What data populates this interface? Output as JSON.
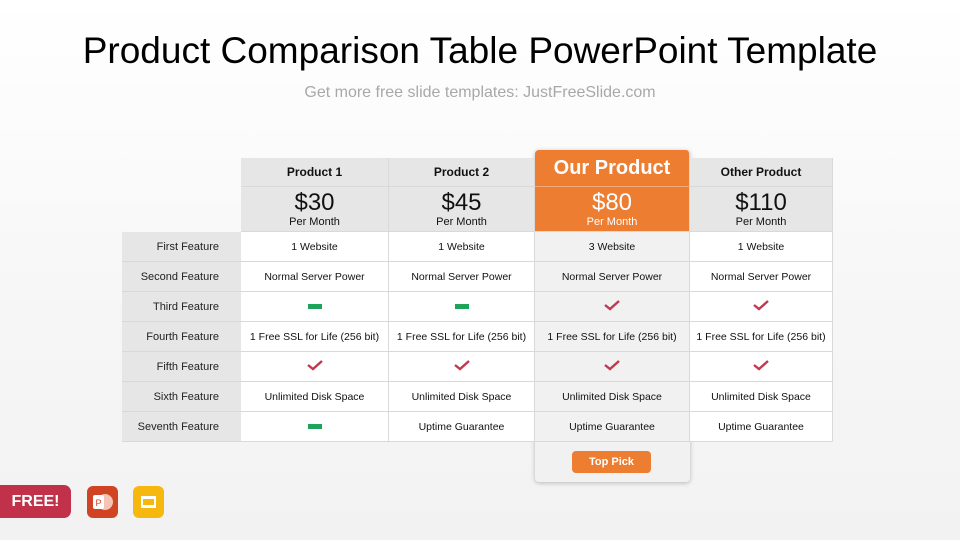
{
  "title": "Product Comparison Table PowerPoint Template",
  "subtitle": "Get more free slide templates: JustFreeSlide.com",
  "accent": "#ed7d31",
  "check_color": "#c0394f",
  "dash_color": "#1fa35a",
  "products": [
    {
      "name": "Product 1",
      "price": "$30",
      "period": "Per Month"
    },
    {
      "name": "Product 2",
      "price": "$45",
      "period": "Per Month"
    },
    {
      "name": "Our Product",
      "price": "$80",
      "period": "Per Month",
      "highlight": true
    },
    {
      "name": "Other Product",
      "price": "$110",
      "period": "Per Month"
    }
  ],
  "rows": [
    {
      "label": "First Feature",
      "cells": [
        "1 Website",
        "1 Website",
        "3 Website",
        "1 Website"
      ]
    },
    {
      "label": "Second Feature",
      "cells": [
        "Normal Server Power",
        "Normal Server Power",
        "Normal Server Power",
        "Normal Server Power"
      ]
    },
    {
      "label": "Third Feature",
      "cells": [
        {
          "icon": "dash-icon"
        },
        {
          "icon": "dash-icon"
        },
        {
          "icon": "check-icon"
        },
        {
          "icon": "check-icon"
        }
      ]
    },
    {
      "label": "Fourth Feature",
      "cells": [
        "1 Free SSL for Life (256 bit)",
        "1 Free SSL for Life (256 bit)",
        "1 Free SSL for Life (256 bit)",
        "1 Free SSL for Life (256 bit)"
      ]
    },
    {
      "label": "Fifth Feature",
      "cells": [
        {
          "icon": "check-icon"
        },
        {
          "icon": "check-icon"
        },
        {
          "icon": "check-icon"
        },
        {
          "icon": "check-icon"
        }
      ]
    },
    {
      "label": "Sixth Feature",
      "cells": [
        "Unlimited Disk Space",
        "Unlimited Disk Space",
        "Unlimited Disk Space",
        "Unlimited Disk Space"
      ]
    },
    {
      "label": "Seventh Feature",
      "cells": [
        {
          "icon": "dash-icon"
        },
        "Uptime Guarantee",
        "Uptime Guarantee",
        "Uptime Guarantee"
      ]
    }
  ],
  "top_pick_label": "Top Pick",
  "free_badge": "FREE!",
  "app_icons": [
    "powerpoint-icon",
    "google-slides-icon"
  ]
}
